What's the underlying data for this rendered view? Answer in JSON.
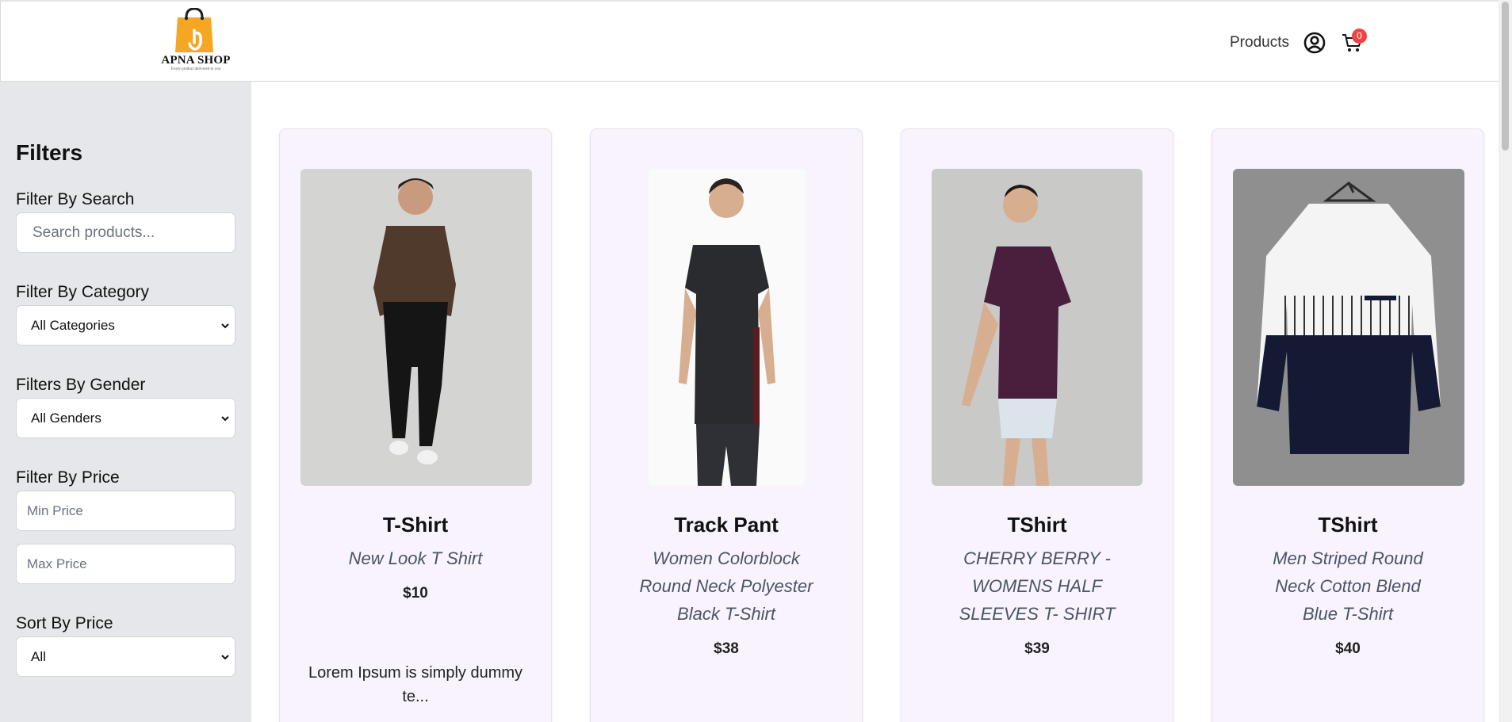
{
  "header": {
    "logo_name": "APNA SHOP",
    "logo_tagline": "Every product delivered to you",
    "nav_products": "Products",
    "cart_count": "0"
  },
  "sidebar": {
    "title": "Filters",
    "search_label": "Filter By Search",
    "search_placeholder": "Search products...",
    "category_label": "Filter By Category",
    "category_value": "All Categories",
    "gender_label": "Filters By Gender",
    "gender_value": "All Genders",
    "price_label": "Filter By Price",
    "min_price_placeholder": "Min Price",
    "max_price_placeholder": "Max Price",
    "sort_label": "Sort By Price",
    "sort_value": "All"
  },
  "products": [
    {
      "name": "T-Shirt",
      "description": "New Look T Shirt",
      "price": "$10",
      "extra": "Lorem Ipsum is simply dummy te..."
    },
    {
      "name": "Track Pant",
      "description": "Women Colorblock Round Neck Polyester Black T-Shirt",
      "price": "$38"
    },
    {
      "name": "TShirt",
      "description": "CHERRY BERRY - WOMENS HALF SLEEVES T- SHIRT",
      "price": "$39"
    },
    {
      "name": "TShirt",
      "description": "Men Striped Round Neck Cotton Blend Blue T-Shirt",
      "price": "$40"
    }
  ],
  "colors": {
    "accent": "#f5a623",
    "badge": "#ef4444",
    "sidebar_bg": "#e5e7eb",
    "card_bg": "#f8f3fd"
  },
  "icons": [
    "shopping-bag-logo",
    "user-circle-icon",
    "cart-icon",
    "chevron-down-icon"
  ]
}
